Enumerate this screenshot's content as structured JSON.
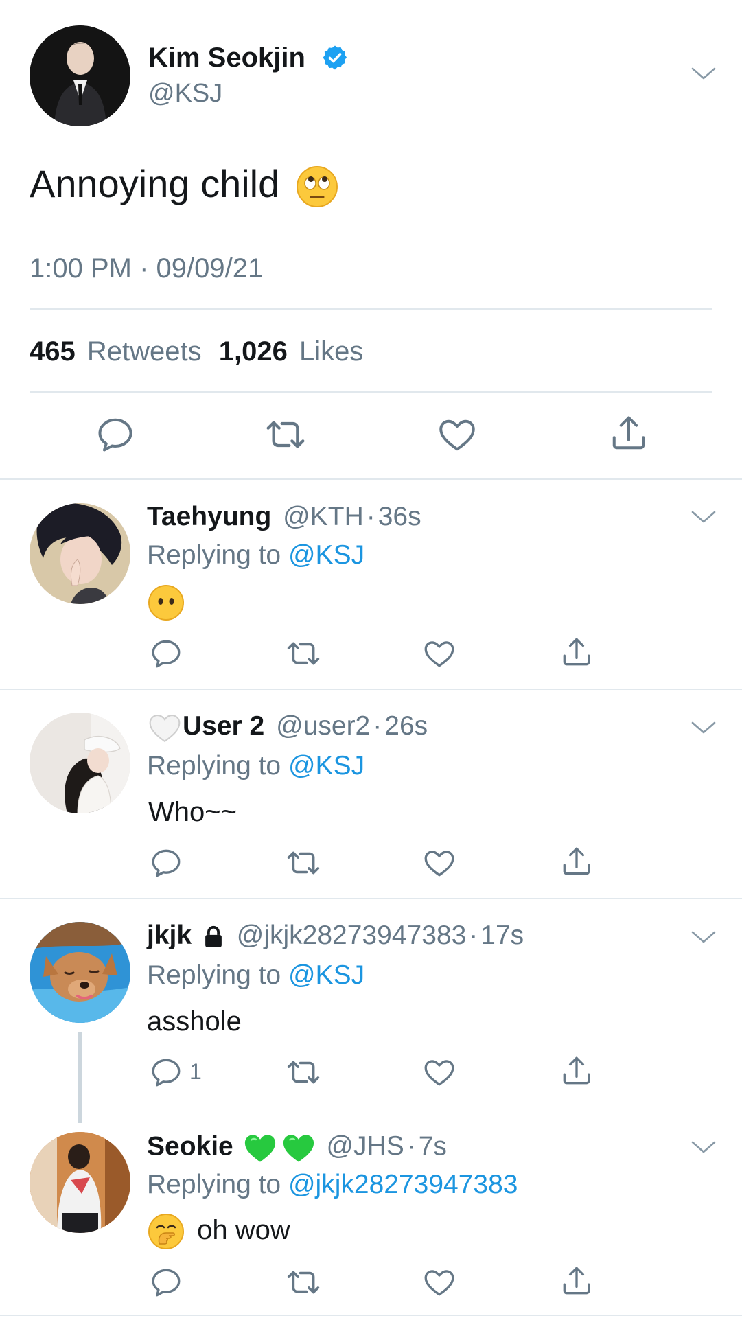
{
  "main_tweet": {
    "name": "Kim Seokjin",
    "handle": "@KSJ",
    "verified_icon": "verified-badge-icon",
    "text": "Annoying child",
    "emoji": "face-with-rolling-eyes",
    "timestamp": "1:00 PM · 09/09/21",
    "retweets_count": "465",
    "retweets_label": "Retweets",
    "likes_count": "1,026",
    "likes_label": "Likes"
  },
  "replies": [
    {
      "name": "Taehyung",
      "handle": "@KTH",
      "sep": "·",
      "time": "36s",
      "replying_prefix": "Replying to",
      "replying_to": "@KSJ",
      "text": "",
      "emoji": "face-without-mouth"
    },
    {
      "name_prefix_emoji": "white-heart",
      "name": "User 2",
      "handle": "@user2",
      "sep": "·",
      "time": "26s",
      "replying_prefix": "Replying to",
      "replying_to": "@KSJ",
      "text": "Who~~"
    },
    {
      "name": "jkjk",
      "lock_icon": "lock-icon",
      "handle": "@jkjk28273947383",
      "sep": "·",
      "time": "17s",
      "replying_prefix": "Replying to",
      "replying_to": "@KSJ",
      "text": "asshole",
      "reply_count": "1"
    },
    {
      "name": "Seokie",
      "name_suffix_emoji": "green-heart green-heart",
      "handle": "@JHS",
      "sep": "·",
      "time": "7s",
      "replying_prefix": "Replying to",
      "replying_to": "@jkjk28273947383",
      "text": "oh wow",
      "emoji": "face-with-hand-over-mouth"
    }
  ],
  "colors": {
    "text": "#14171a",
    "muted": "#657786",
    "link": "#1b95e0",
    "divider": "#e1e8ed",
    "verified": "#1da1f2",
    "heart_green": "#2ecc40"
  }
}
